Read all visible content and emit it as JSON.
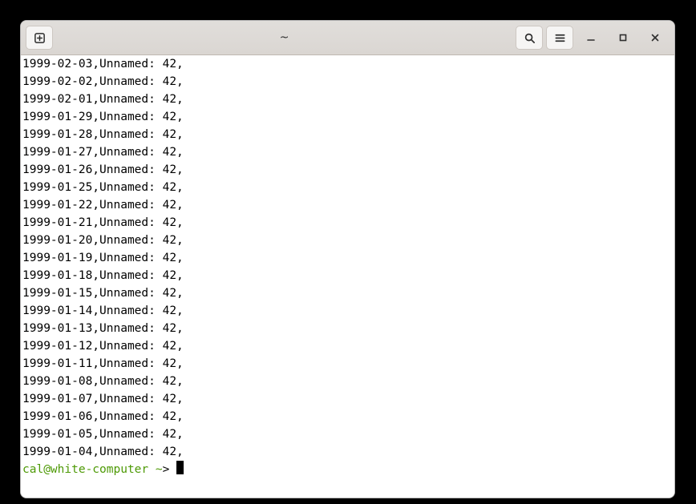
{
  "window": {
    "title": "~"
  },
  "terminal": {
    "lines": [
      "1999-02-03,Unnamed: 42,",
      "1999-02-02,Unnamed: 42,",
      "1999-02-01,Unnamed: 42,",
      "1999-01-29,Unnamed: 42,",
      "1999-01-28,Unnamed: 42,",
      "1999-01-27,Unnamed: 42,",
      "1999-01-26,Unnamed: 42,",
      "1999-01-25,Unnamed: 42,",
      "1999-01-22,Unnamed: 42,",
      "1999-01-21,Unnamed: 42,",
      "1999-01-20,Unnamed: 42,",
      "1999-01-19,Unnamed: 42,",
      "1999-01-18,Unnamed: 42,",
      "1999-01-15,Unnamed: 42,",
      "1999-01-14,Unnamed: 42,",
      "1999-01-13,Unnamed: 42,",
      "1999-01-12,Unnamed: 42,",
      "1999-01-11,Unnamed: 42,",
      "1999-01-08,Unnamed: 42,",
      "1999-01-07,Unnamed: 42,",
      "1999-01-06,Unnamed: 42,",
      "1999-01-05,Unnamed: 42,",
      "1999-01-04,Unnamed: 42,"
    ],
    "prompt": {
      "user_host": "cal@white-computer",
      "path": "~",
      "symbol": ">"
    }
  }
}
